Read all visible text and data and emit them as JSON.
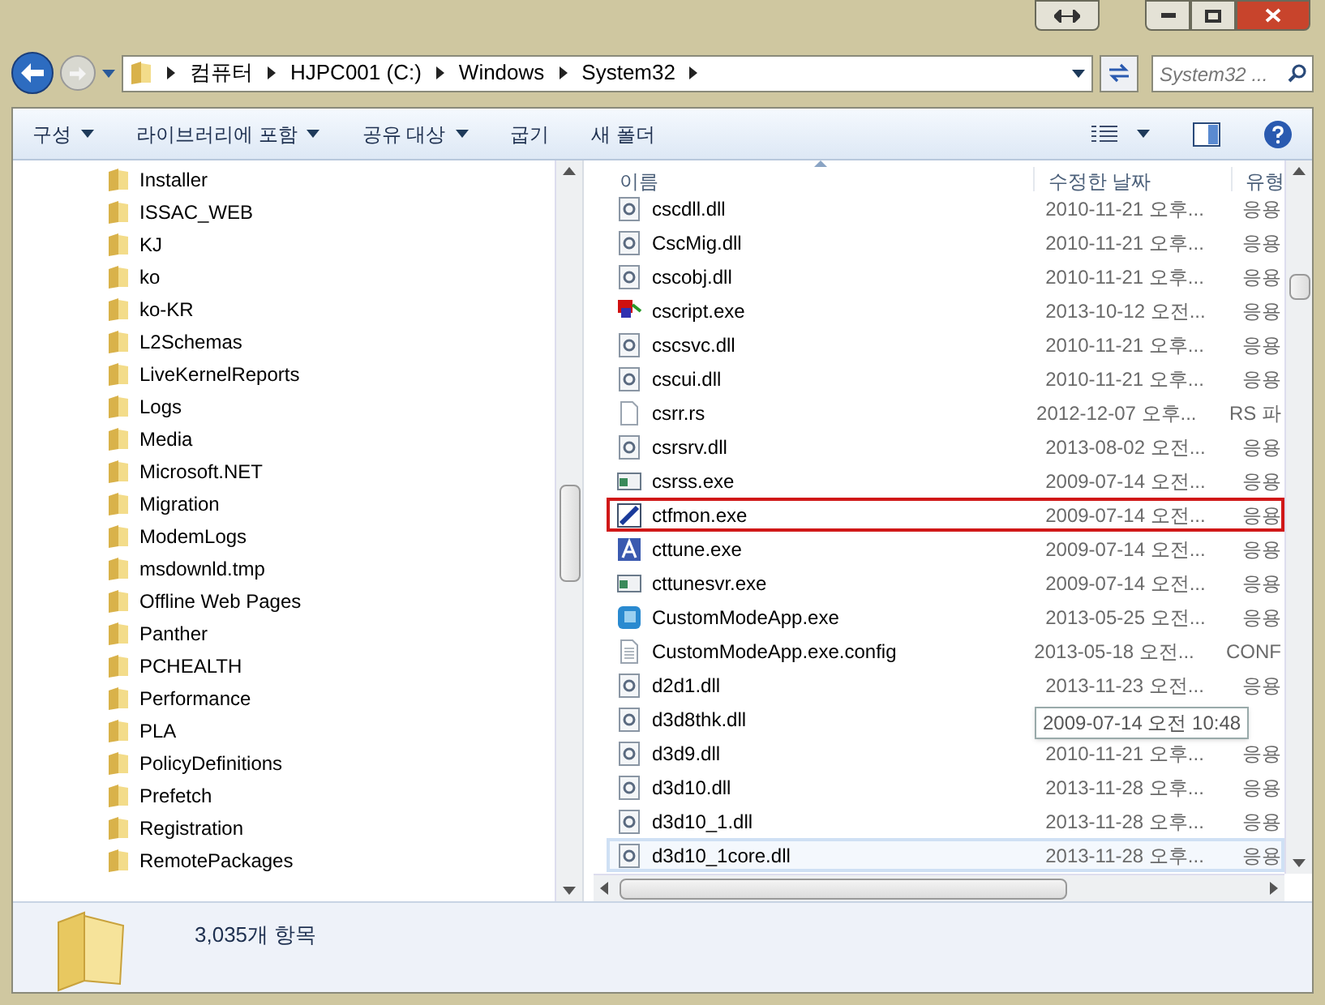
{
  "address_bar": {
    "path": [
      "컴퓨터",
      "HJPC001 (C:)",
      "Windows",
      "System32"
    ],
    "search_placeholder": "System32 ..."
  },
  "toolbar": {
    "items": [
      {
        "label": "구성",
        "dropdown": true
      },
      {
        "label": "라이브러리에 포함",
        "dropdown": true
      },
      {
        "label": "공유 대상",
        "dropdown": true
      },
      {
        "label": "굽기",
        "dropdown": false
      },
      {
        "label": "새 폴더",
        "dropdown": false
      }
    ]
  },
  "folders": [
    "Installer",
    "ISSAC_WEB",
    "KJ",
    "ko",
    "ko-KR",
    "L2Schemas",
    "LiveKernelReports",
    "Logs",
    "Media",
    "Microsoft.NET",
    "Migration",
    "ModemLogs",
    "msdownld.tmp",
    "Offline Web Pages",
    "Panther",
    "PCHEALTH",
    "Performance",
    "PLA",
    "PolicyDefinitions",
    "Prefetch",
    "Registration",
    "RemotePackages"
  ],
  "file_list": {
    "columns": [
      "이름",
      "수정한 날짜",
      "유형"
    ],
    "rows": [
      {
        "name": "cscdll.dll",
        "date": "2010-11-21 오후...",
        "type": "응용",
        "kind": "dll",
        "highlighted": false,
        "hovered": false
      },
      {
        "name": "CscMig.dll",
        "date": "2010-11-21 오후...",
        "type": "응용",
        "kind": "dll",
        "highlighted": false,
        "hovered": false
      },
      {
        "name": "cscobj.dll",
        "date": "2010-11-21 오후...",
        "type": "응용",
        "kind": "dll",
        "highlighted": false,
        "hovered": false
      },
      {
        "name": "cscript.exe",
        "date": "2013-10-12 오전...",
        "type": "응용",
        "kind": "script",
        "highlighted": false,
        "hovered": false
      },
      {
        "name": "cscsvc.dll",
        "date": "2010-11-21 오후...",
        "type": "응용",
        "kind": "dll",
        "highlighted": false,
        "hovered": false
      },
      {
        "name": "cscui.dll",
        "date": "2010-11-21 오후...",
        "type": "응용",
        "kind": "dll",
        "highlighted": false,
        "hovered": false
      },
      {
        "name": "csrr.rs",
        "date": "2012-12-07 오후...",
        "type": "RS 파",
        "kind": "blank",
        "highlighted": false,
        "hovered": false
      },
      {
        "name": "csrsrv.dll",
        "date": "2013-08-02 오전...",
        "type": "응용",
        "kind": "dll",
        "highlighted": false,
        "hovered": false
      },
      {
        "name": "csrss.exe",
        "date": "2009-07-14 오전...",
        "type": "응용",
        "kind": "window",
        "highlighted": false,
        "hovered": false
      },
      {
        "name": "ctfmon.exe",
        "date": "2009-07-14 오전...",
        "type": "응용",
        "kind": "pen",
        "highlighted": true,
        "hovered": false
      },
      {
        "name": "cttune.exe",
        "date": "2009-07-14 오전...",
        "type": "응용",
        "kind": "font",
        "highlighted": false,
        "hovered": false
      },
      {
        "name": "cttunesvr.exe",
        "date": "2009-07-14 오전...",
        "type": "응용",
        "kind": "window",
        "highlighted": false,
        "hovered": false
      },
      {
        "name": "CustomModeApp.exe",
        "date": "2013-05-25 오전...",
        "type": "응용",
        "kind": "app",
        "highlighted": false,
        "hovered": false
      },
      {
        "name": "CustomModeApp.exe.config",
        "date": "2013-05-18 오전...",
        "type": "CONF",
        "kind": "config",
        "highlighted": false,
        "hovered": false
      },
      {
        "name": "d2d1.dll",
        "date": "2013-11-23 오전...",
        "type": "응용",
        "kind": "dll",
        "highlighted": false,
        "hovered": false
      },
      {
        "name": "d3d8thk.dll",
        "tooltip": "2009-07-14 오전 10:48",
        "kind": "dll",
        "highlighted": false,
        "hovered": false
      },
      {
        "name": "d3d9.dll",
        "date": "2010-11-21 오후...",
        "type": "응용",
        "kind": "dll",
        "highlighted": false,
        "hovered": false
      },
      {
        "name": "d3d10.dll",
        "date": "2013-11-28 오후...",
        "type": "응용",
        "kind": "dll",
        "highlighted": false,
        "hovered": false
      },
      {
        "name": "d3d10_1.dll",
        "date": "2013-11-28 오후...",
        "type": "응용",
        "kind": "dll",
        "highlighted": false,
        "hovered": false
      },
      {
        "name": "d3d10_1core.dll",
        "date": "2013-11-28 오후...",
        "type": "응용",
        "kind": "dll",
        "highlighted": false,
        "hovered": true
      }
    ]
  },
  "status_bar": {
    "count": "3,035개 항목"
  }
}
